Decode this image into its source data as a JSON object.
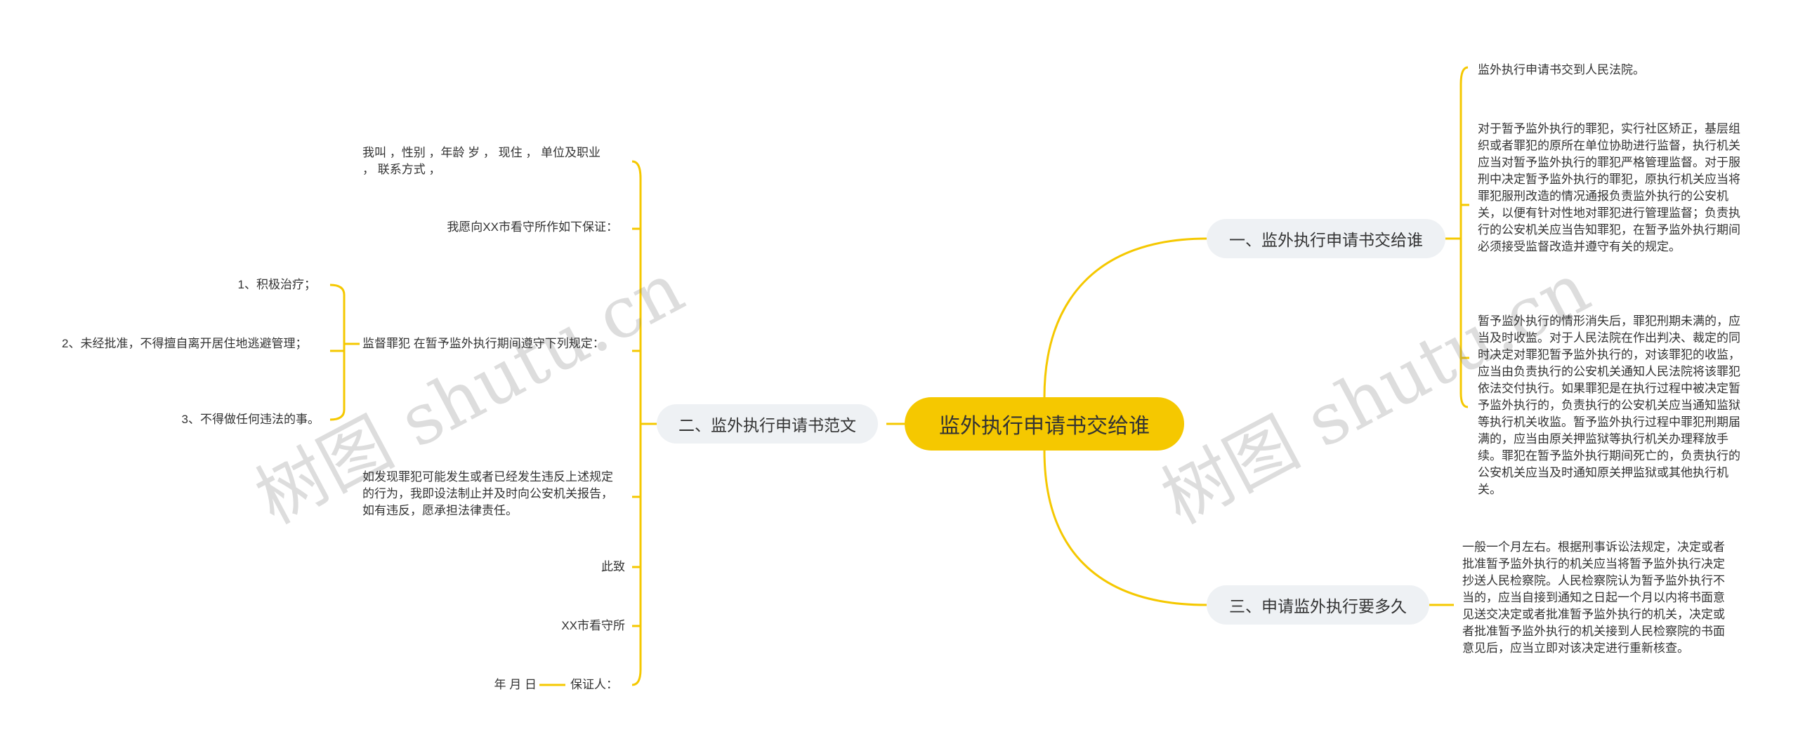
{
  "colors": {
    "accent": "#f5c800",
    "branch_bg": "#eef1f4",
    "text": "#333333"
  },
  "root": {
    "label": "监外执行申请书交给谁"
  },
  "branches": {
    "b1": {
      "label": "一、监外执行申请书交给谁"
    },
    "b2": {
      "label": "二、监外执行申请书范文"
    },
    "b3": {
      "label": "三、申请监外执行要多久"
    }
  },
  "b1_leaves": [
    "监外执行申请书交到人民法院。",
    "对于暂予监外执行的罪犯，实行社区矫正，基层组织或者罪犯的原所在单位协助进行监督，执行机关应当对暂予监外执行的罪犯严格管理监督。对于服刑中决定暂予监外执行的罪犯，原执行机关应当将罪犯服刑改造的情况通报负责监外执行的公安机关，以便有针对性地对罪犯进行管理监督；负责执行的公安机关应当告知罪犯，在暂予监外执行期间必须接受监督改造并遵守有关的规定。",
    "暂予监外执行的情形消失后，罪犯刑期未满的，应当及时收监。对于人民法院在作出判决、裁定的同时决定对罪犯暂予监外执行的，对该罪犯的收监，应当由负责执行的公安机关通知人民法院将该罪犯依法交付执行。如果罪犯是在执行过程中被决定暂予监外执行的，负责执行的公安机关应当通知监狱等执行机关收监。暂予监外执行过程中罪犯刑期届满的，应当由原关押监狱等执行机关办理释放手续。罪犯在暂予监外执行期间死亡的，负责执行的公安机关应当及时通知原关押监狱或其他执行机关。"
  ],
  "b3_leaves": [
    "一般一个月左右。根据刑事诉讼法规定，决定或者批准暂予监外执行的机关应当将暂予监外执行决定抄送人民检察院。人民检察院认为暂予监外执行不当的，应当自接到通知之日起一个月以内将书面意见送交决定或者批准暂予监外执行的机关，决定或者批准暂予监外执行的机关接到人民检察院的书面意见后，应当立即对该决定进行重新核查。"
  ],
  "b2_leaves": [
    "我叫 ，性别 ，年龄 岁 ， 现住 ， 单位及职业 ， 联系方式 ，",
    "我愿向XX市看守所作如下保证：",
    "监督罪犯 在暂予监外执行期间遵守下列规定：",
    "如发现罪犯可能发生或者已经发生违反上述规定的行为，我即设法制止并及时向公安机关报告，如有违反，愿承担法律责任。",
    "此致",
    "XX市看守所",
    "保证人："
  ],
  "b2_sub": [
    "1、积极治疗；",
    "2、未经批准，不得擅自离开居住地逃避管理；",
    "3、不得做任何违法的事。"
  ],
  "b2_date": "年 月 日",
  "watermark": "树图 shutu.cn"
}
